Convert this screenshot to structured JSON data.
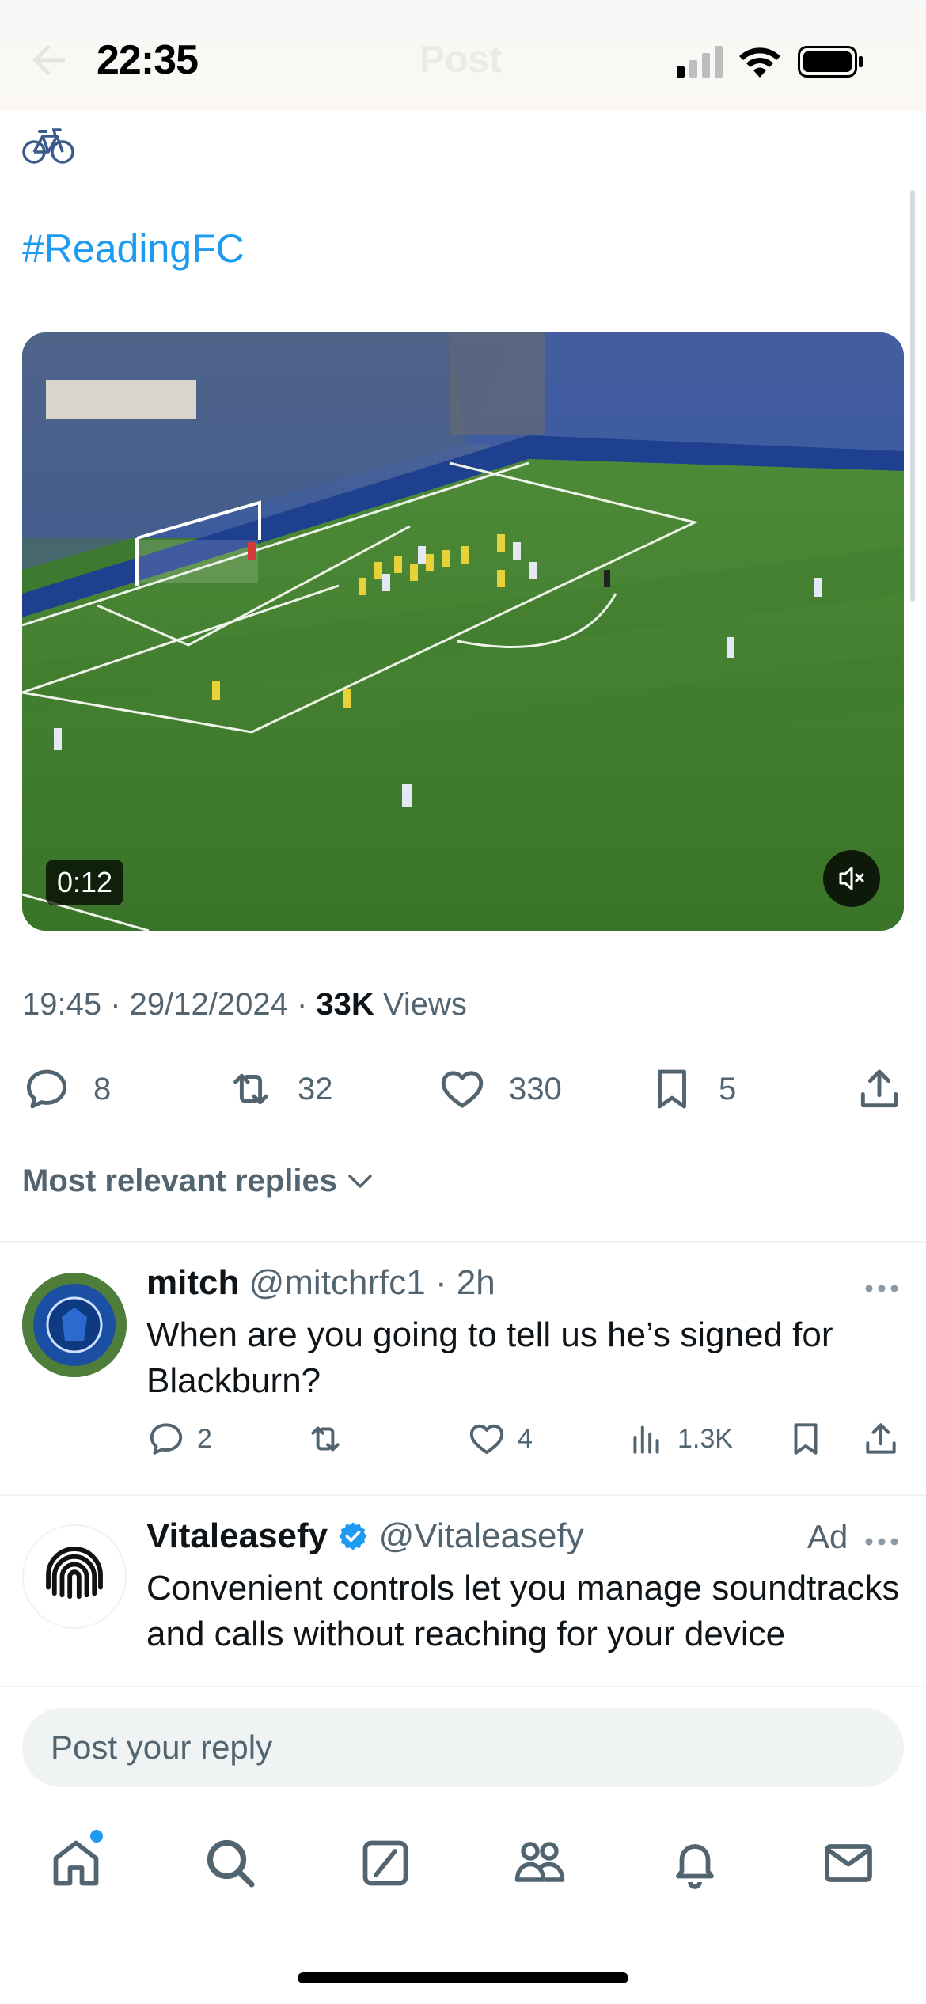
{
  "status_bar": {
    "time": "22:35"
  },
  "header": {
    "title": "Post"
  },
  "tweet": {
    "emoji_icon": "bicycle-icon",
    "hashtag": "#ReadingFC",
    "video": {
      "duration": "0:12",
      "muted": true
    },
    "timestamp": "19:45 · 29/12/2024 · ",
    "views_count": "33K",
    "views_label": " Views",
    "actions": {
      "replies": "8",
      "reposts": "32",
      "likes": "330",
      "bookmarks": "5"
    }
  },
  "sort": {
    "label": "Most relevant replies"
  },
  "replies": [
    {
      "name": "mitch",
      "handle": "@mitchrfc1",
      "time": " · 2h",
      "text": "When are you going to tell us he’s signed for Blackburn?",
      "replies": "2",
      "reposts": "",
      "likes": "4",
      "views": "1.3K"
    },
    {
      "name": "Vitaleasefy",
      "verified": true,
      "handle": "@Vitaleasefy",
      "ad_label": "Ad",
      "text": "Convenient controls let you manage soundtracks and calls without reaching for your device"
    }
  ],
  "composer": {
    "placeholder": "Post your reply"
  },
  "tab_bar": {
    "tabs": [
      "home-icon",
      "search-icon",
      "grok-icon",
      "communities-icon",
      "notifications-icon",
      "messages-icon"
    ],
    "home_has_dot": true
  },
  "colors": {
    "accent": "#1d9bf0",
    "secondary_text": "#536471",
    "primary_text": "#0f1419"
  }
}
